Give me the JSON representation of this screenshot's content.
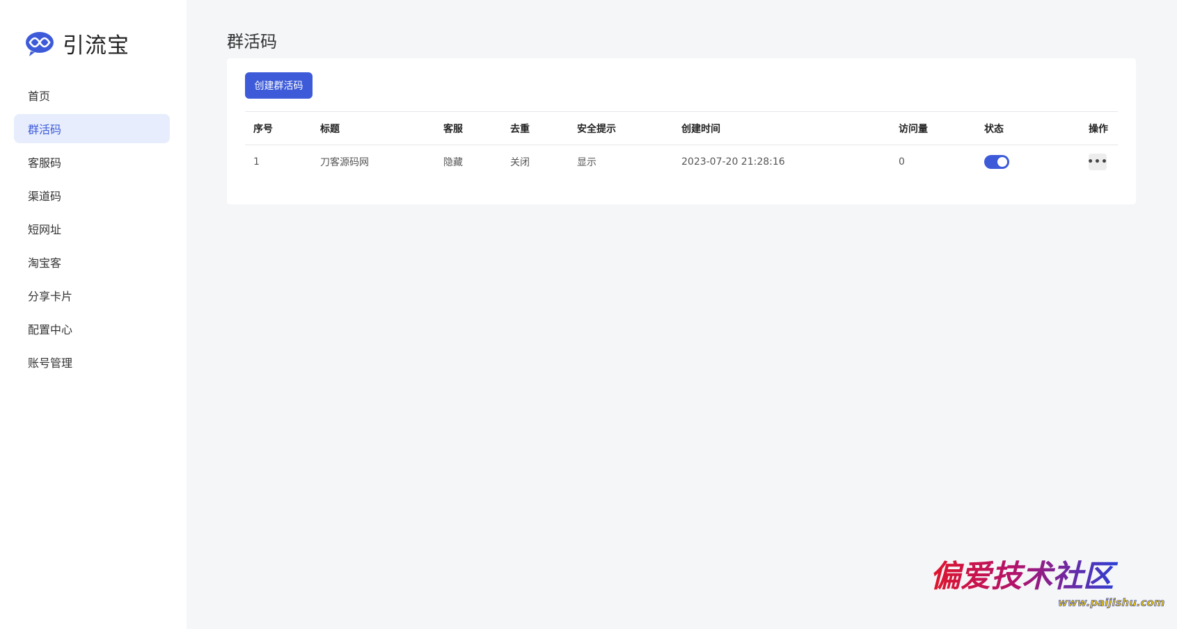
{
  "app": {
    "name": "引流宝",
    "brand_color": "#3d5bd9"
  },
  "sidebar": {
    "items": [
      {
        "label": "首页",
        "active": false
      },
      {
        "label": "群活码",
        "active": true
      },
      {
        "label": "客服码",
        "active": false
      },
      {
        "label": "渠道码",
        "active": false
      },
      {
        "label": "短网址",
        "active": false
      },
      {
        "label": "淘宝客",
        "active": false
      },
      {
        "label": "分享卡片",
        "active": false
      },
      {
        "label": "配置中心",
        "active": false
      },
      {
        "label": "账号管理",
        "active": false
      }
    ]
  },
  "main": {
    "title": "群活码",
    "create_button": "创建群活码",
    "table": {
      "headers": [
        "序号",
        "标题",
        "客服",
        "去重",
        "安全提示",
        "创建时间",
        "访问量",
        "状态",
        "操作"
      ],
      "rows": [
        {
          "index": "1",
          "title": "刀客源码网",
          "service": "隐藏",
          "dedup": "关闭",
          "safety_tip": "显示",
          "created": "2023-07-20 21:28:16",
          "visits": "0",
          "status_on": true,
          "action_icon": "more-icon"
        }
      ]
    }
  },
  "watermark": {
    "text": "偏爱技术社区",
    "url": "www.paijishu.com"
  }
}
